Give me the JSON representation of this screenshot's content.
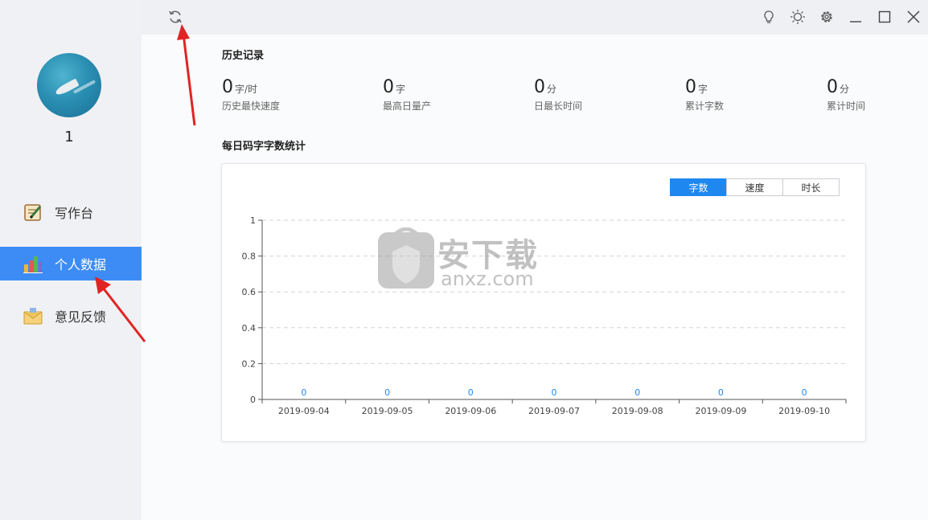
{
  "profile": {
    "username": "1"
  },
  "sidebar": {
    "items": [
      {
        "label": "写作台",
        "icon": "notepad-icon",
        "active": false
      },
      {
        "label": "个人数据",
        "icon": "bar-chart-icon",
        "active": true
      },
      {
        "label": "意见反馈",
        "icon": "envelope-icon",
        "active": false
      }
    ]
  },
  "titlebar": {
    "icons": [
      "refresh-icon",
      "lightbulb-icon",
      "sun-icon",
      "gear-icon",
      "minimize-icon",
      "maximize-icon",
      "close-icon"
    ]
  },
  "history": {
    "title": "历史记录",
    "stats": [
      {
        "value": "0",
        "unit": "字/时",
        "label": "历史最快速度"
      },
      {
        "value": "0",
        "unit": "字",
        "label": "最高日量产"
      },
      {
        "value": "0",
        "unit": "分",
        "label": "日最长时间"
      },
      {
        "value": "0",
        "unit": "字",
        "label": "累计字数"
      },
      {
        "value": "0",
        "unit": "分",
        "label": "累计时间"
      }
    ]
  },
  "daily": {
    "title": "每日码字字数统计",
    "tabs": [
      {
        "label": "字数",
        "active": true
      },
      {
        "label": "速度",
        "active": false
      },
      {
        "label": "时长",
        "active": false
      }
    ]
  },
  "watermark": {
    "text": "安下载",
    "sub": "anxz.com"
  },
  "chart_data": {
    "type": "bar",
    "categories": [
      "2019-09-04",
      "2019-09-05",
      "2019-09-06",
      "2019-09-07",
      "2019-09-08",
      "2019-09-09",
      "2019-09-10"
    ],
    "values": [
      0,
      0,
      0,
      0,
      0,
      0,
      0
    ],
    "yticks": [
      "1",
      "0.8",
      "0.6",
      "0.4",
      "0.2",
      "0"
    ],
    "ylim": [
      0,
      1
    ],
    "grid": true,
    "data_labels": true,
    "colors": {
      "label": "#1e88f0",
      "grid": "#cfd3d9",
      "axis": "#555555"
    }
  }
}
